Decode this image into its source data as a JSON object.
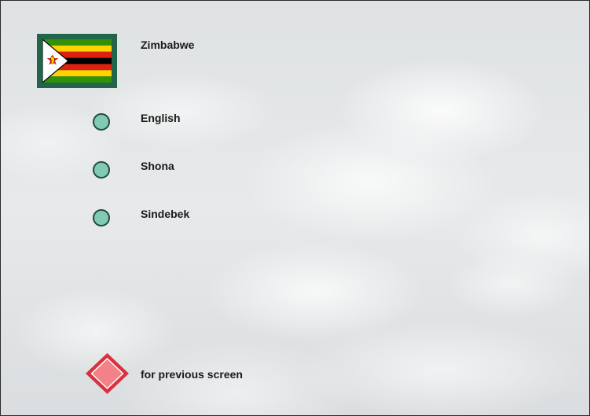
{
  "country": {
    "name": "Zimbabwe",
    "flag_icon": "zimbabwe-flag-icon"
  },
  "languages": [
    {
      "label": "English"
    },
    {
      "label": "Shona"
    },
    {
      "label": "Sindebek"
    }
  ],
  "navigation": {
    "previous_label": "for previous screen",
    "previous_icon": "red-diamond-button-icon"
  },
  "colors": {
    "flag_frame": "#22654a",
    "radio_fill": "#7fcbb6",
    "radio_border": "#23493d",
    "back_button": "#e0404a",
    "background": "#e4e6e7"
  }
}
